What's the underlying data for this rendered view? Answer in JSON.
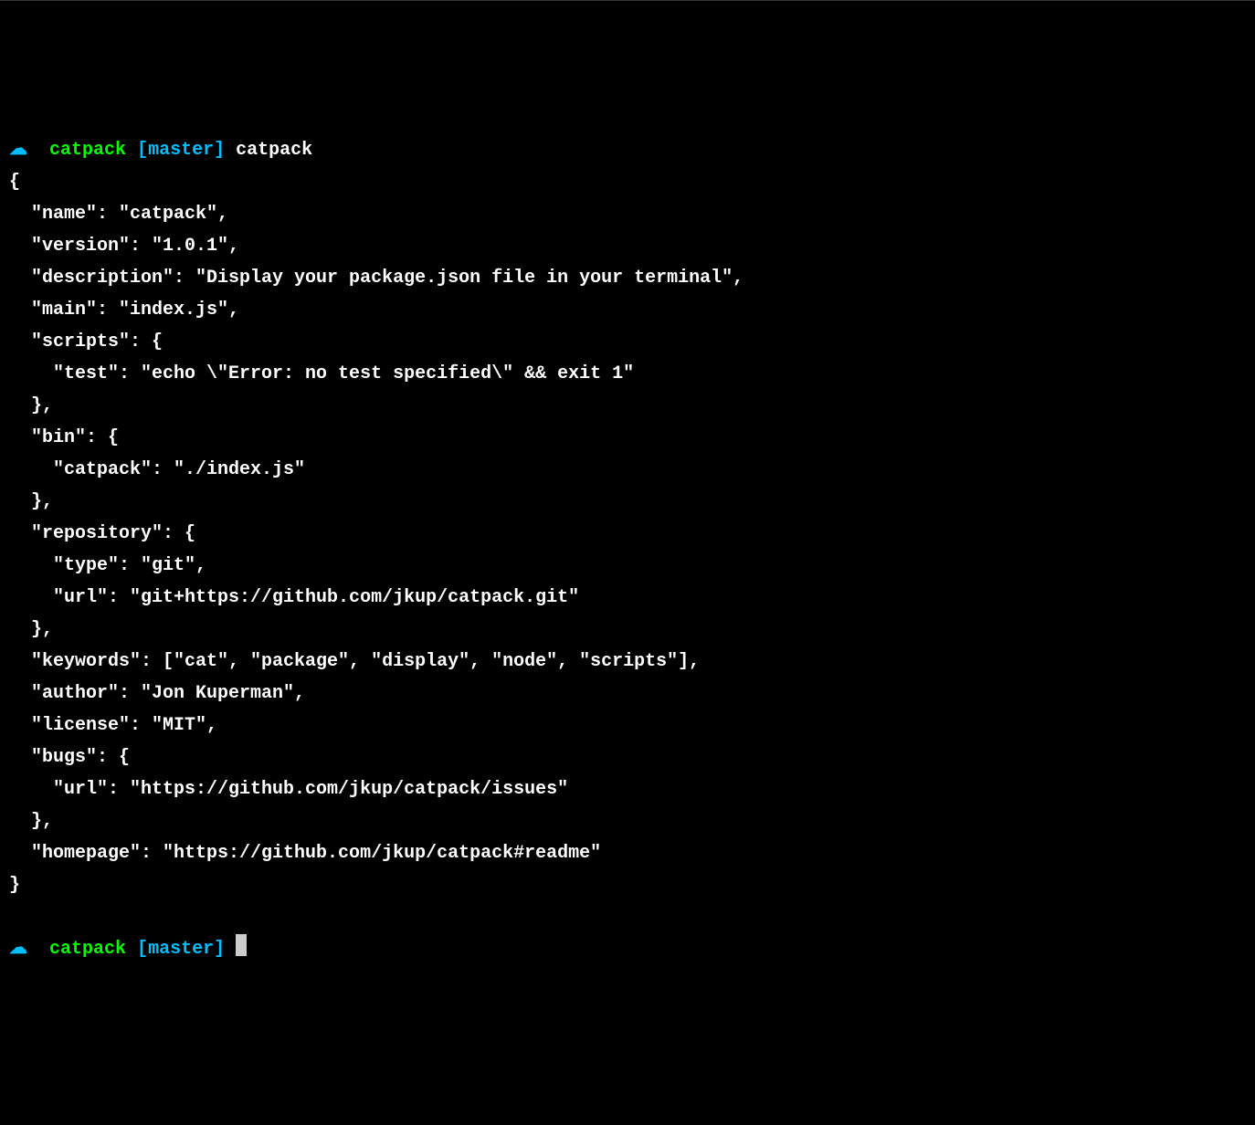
{
  "prompt1": {
    "icon": "☁",
    "dir": "catpack",
    "branch_open": "[",
    "branch": "master",
    "branch_close": "]",
    "command": "catpack"
  },
  "output": {
    "l1": "{",
    "l2": "  \"name\": \"catpack\",",
    "l3": "  \"version\": \"1.0.1\",",
    "l4": "  \"description\": \"Display your package.json file in your terminal\",",
    "l5": "  \"main\": \"index.js\",",
    "l6": "  \"scripts\": {",
    "l7": "    \"test\": \"echo \\\"Error: no test specified\\\" && exit 1\"",
    "l8": "  },",
    "l9": "  \"bin\": {",
    "l10": "    \"catpack\": \"./index.js\"",
    "l11": "  },",
    "l12": "  \"repository\": {",
    "l13": "    \"type\": \"git\",",
    "l14": "    \"url\": \"git+https://github.com/jkup/catpack.git\"",
    "l15": "  },",
    "l16": "  \"keywords\": [\"cat\", \"package\", \"display\", \"node\", \"scripts\"],",
    "l17": "  \"author\": \"Jon Kuperman\",",
    "l18": "  \"license\": \"MIT\",",
    "l19": "  \"bugs\": {",
    "l20": "    \"url\": \"https://github.com/jkup/catpack/issues\"",
    "l21": "  },",
    "l22": "  \"homepage\": \"https://github.com/jkup/catpack#readme\"",
    "l23": "}"
  },
  "prompt2": {
    "icon": "☁",
    "dir": "catpack",
    "branch_open": "[",
    "branch": "master",
    "branch_close": "]"
  }
}
